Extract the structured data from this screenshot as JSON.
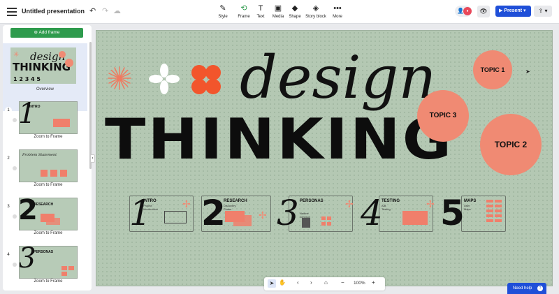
{
  "app": {
    "document_title": "Untitled presentation"
  },
  "toolbar": {
    "tools": [
      {
        "label": "Style",
        "icon": "style-brush-icon"
      },
      {
        "label": "Frame",
        "icon": "frame-icon"
      },
      {
        "label": "Text",
        "icon": "text-icon"
      },
      {
        "label": "Media",
        "icon": "media-icon"
      },
      {
        "label": "Shape",
        "icon": "shape-icon"
      },
      {
        "label": "Story block",
        "icon": "story-block-icon"
      },
      {
        "label": "More",
        "icon": "more-icon"
      }
    ],
    "present_label": "Present"
  },
  "sidebar": {
    "add_frame_label": "Add frame",
    "overview_label": "Overview",
    "frames": [
      {
        "number": "1",
        "title": "INTRO",
        "label": "Zoom to Frame"
      },
      {
        "number": "2",
        "title": "Problem Statement",
        "label": "Zoom to Frame"
      },
      {
        "number": "3",
        "title": "RESEARCH",
        "label": "Zoom to Frame"
      },
      {
        "number": "4",
        "title": "PERSONAS",
        "label": "Zoom to Frame"
      }
    ]
  },
  "canvas": {
    "heading_script": "design",
    "heading_bold": "THINKING",
    "topics": [
      "TOPIC 1",
      "TOPIC 3",
      "TOPIC 2"
    ],
    "steps": [
      {
        "number": "1",
        "title": "INTRO",
        "subtitle": "Project Introduction"
      },
      {
        "number": "2",
        "title": "RESEARCH",
        "subtitle": "Discovery Phase"
      },
      {
        "number": "3",
        "title": "PERSONAS",
        "subtitle": "Nadine Johnson"
      },
      {
        "number": "4",
        "title": "TESTING",
        "subtitle": "A/B Testing"
      },
      {
        "number": "5",
        "title": "MAPS",
        "subtitle": "User Maps"
      }
    ],
    "colors": {
      "background": "#b4c8b3",
      "accent": "#f08a73"
    }
  },
  "bottom_toolbar": {
    "zoom_level": "100%"
  },
  "help": {
    "label": "Need help"
  }
}
